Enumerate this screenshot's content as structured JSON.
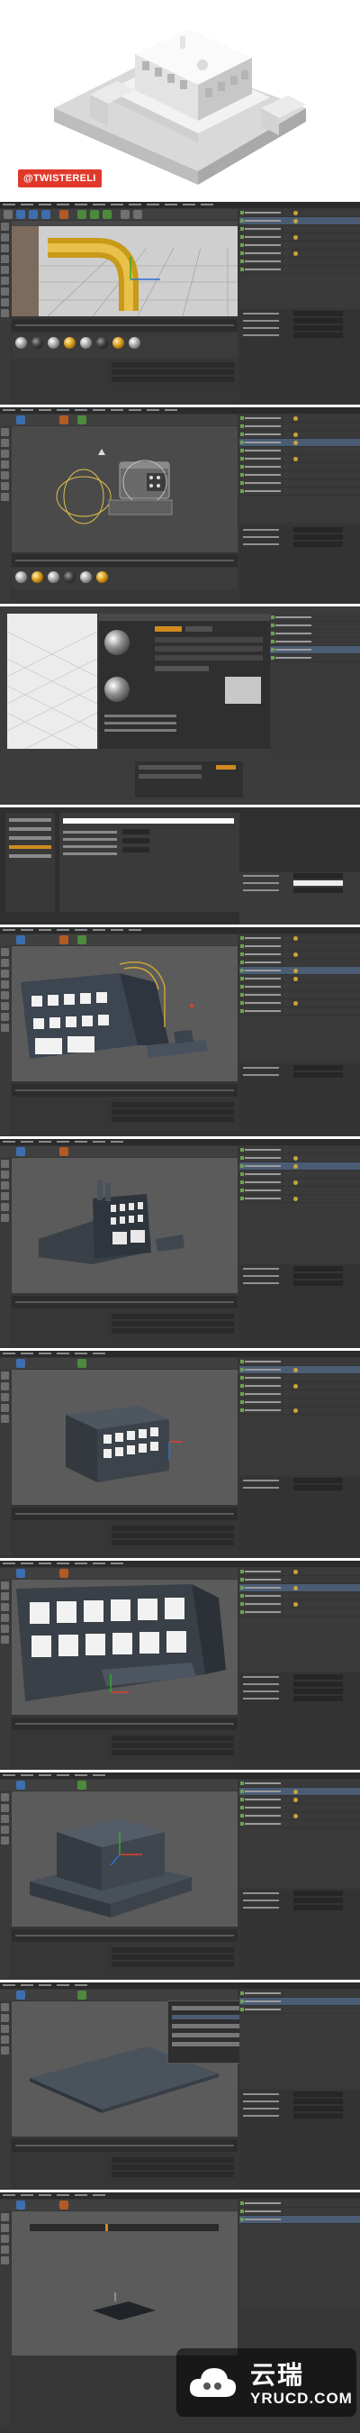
{
  "hero": {
    "badge_text": "@TWISTERELI",
    "accent_color": "#e0392b"
  },
  "theme": {
    "panel_bg": "#363636",
    "viewport_bg": "#5b5b5b",
    "selection": "#4b5c75"
  },
  "panels": [
    {
      "name": "panel-1-pipe-viewport",
      "content": "yellow-bent-pipe"
    },
    {
      "name": "panel-2-xpresso",
      "content": "node-editor"
    },
    {
      "name": "panel-3-material-editor",
      "content": "reflection-material"
    },
    {
      "name": "panel-4-preferences",
      "content": "settings-dialog"
    },
    {
      "name": "panel-5-building-front",
      "content": "building-with-pipe"
    },
    {
      "name": "panel-6-building-perspective",
      "content": "building-side"
    },
    {
      "name": "panel-7-building-block",
      "content": "building-windows"
    },
    {
      "name": "panel-8-facade-closeup",
      "content": "facade-windows"
    },
    {
      "name": "panel-9-box-modeling",
      "content": "block-extrude"
    },
    {
      "name": "panel-10-base-plane",
      "content": "flat-plane"
    },
    {
      "name": "panel-11-timeline-plane",
      "content": "plane-timeline"
    }
  ],
  "icons": {
    "cloud": "cloud-icon",
    "move_tool": "move-tool-icon",
    "gear": "gear-icon"
  },
  "watermark": {
    "chinese": "云瑞",
    "domain": "YRUCD.COM"
  }
}
